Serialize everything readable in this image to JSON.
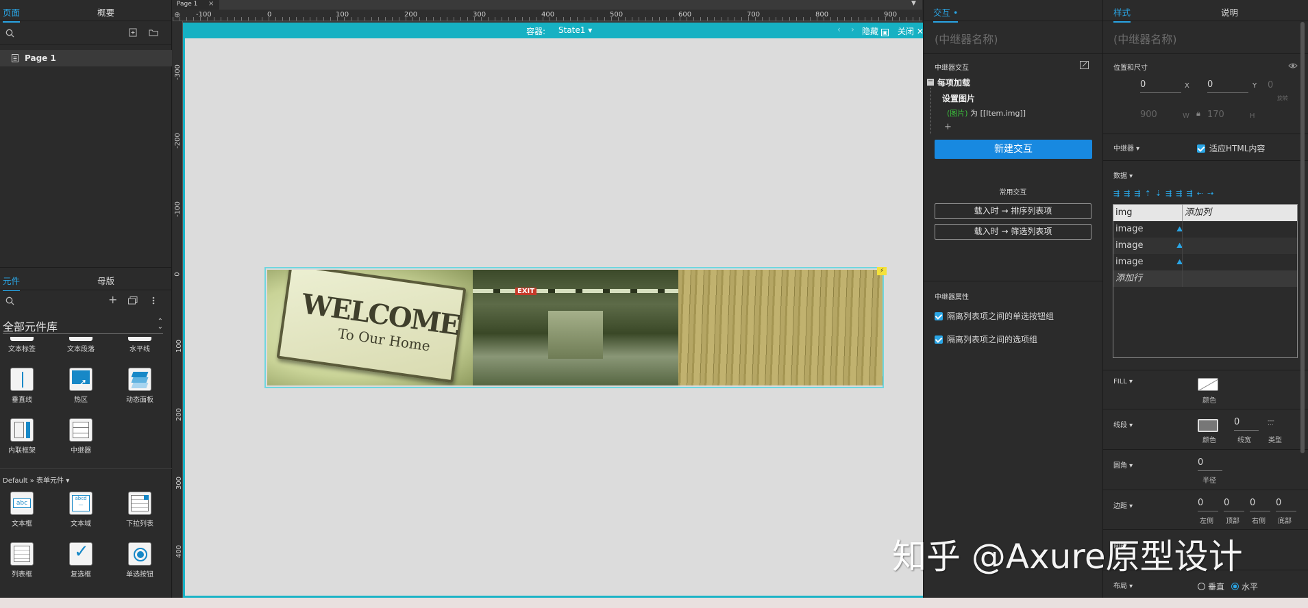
{
  "left_panel": {
    "tabs": [
      "页面",
      "概要"
    ],
    "page_item": "Page 1",
    "lib_tabs": [
      "元件",
      "母版"
    ],
    "library_select": "全部元件库",
    "partial_row": [
      "文本标签",
      "文本段落",
      "水平线"
    ],
    "components_row1": [
      "垂直线",
      "热区",
      "动态面板"
    ],
    "components_row2": [
      "内联框架",
      "中继器"
    ],
    "section": "Default » 表单元件 ▾",
    "components_row3": [
      "文本框",
      "文本域",
      "下拉列表"
    ],
    "components_row4": [
      "列表框",
      "复选框",
      "单选按钮"
    ]
  },
  "canvas": {
    "tab": "Page 1",
    "ruler_top": [
      "-100",
      "0",
      "100",
      "200",
      "300",
      "400",
      "500",
      "600",
      "700",
      "800",
      "900"
    ],
    "ruler_left": [
      "-300",
      "-200",
      "-100",
      "0",
      "100",
      "200",
      "300",
      "400"
    ],
    "container_label": "容器:",
    "state": "State1",
    "hide": "隐藏",
    "close": "关闭",
    "image1_line1": "WELCOME",
    "image1_line2": "To Our Home",
    "image2_sign": "EXIT"
  },
  "interaction_panel": {
    "tab": "交互",
    "name_placeholder": "(中继器名称)",
    "section": "中继器交互",
    "event": "每项加载",
    "action": "设置图片",
    "detail_green": "(图片)",
    "detail_rest": "为 [[Item.img]]",
    "add": "+",
    "new_button": "新建交互",
    "common": "常用交互",
    "common1": "载入时 → 排序列表项",
    "common2": "载入时 → 筛选列表项",
    "props_title": "中继器属性",
    "prop1": "隔离列表项之间的单选按钮组",
    "prop2": "隔离列表项之间的选项组"
  },
  "style_panel": {
    "tabs": [
      "样式",
      "说明"
    ],
    "name_placeholder": "(中继器名称)",
    "pos_title": "位置和尺寸",
    "x": "0",
    "x_lbl": "X",
    "y": "0",
    "y_lbl": "Y",
    "rot": "0",
    "rot_lbl": "旋转",
    "w": "900",
    "w_lbl": "W",
    "h": "170",
    "h_lbl": "H",
    "repeater_lbl": "中继器 ▾",
    "fit_html": "适应HTML内容",
    "data_lbl": "数据 ▾",
    "table_header": [
      "img",
      "添加列"
    ],
    "table_rows": [
      "image",
      "image",
      "image"
    ],
    "add_row": "添加行",
    "fill_lbl": "FILL ▾",
    "fill_color": "颜色",
    "line_lbl": "线段 ▾",
    "line_color": "颜色",
    "line_width_val": "0",
    "line_width": "线宽",
    "line_type": "类型",
    "radius_lbl": "圆角 ▾",
    "radius_val": "0",
    "radius": "半径",
    "padding_lbl": "边距 ▾",
    "padding_vals": [
      "0",
      "0",
      "0",
      "0"
    ],
    "padding_names": [
      "左侧",
      "顶部",
      "右侧",
      "底部"
    ],
    "spacing_lbl": "间距",
    "layout_lbl": "布局 ▾",
    "layout_v": "垂直",
    "layout_h": "水平"
  },
  "watermark": "知乎 @Axure原型设计"
}
